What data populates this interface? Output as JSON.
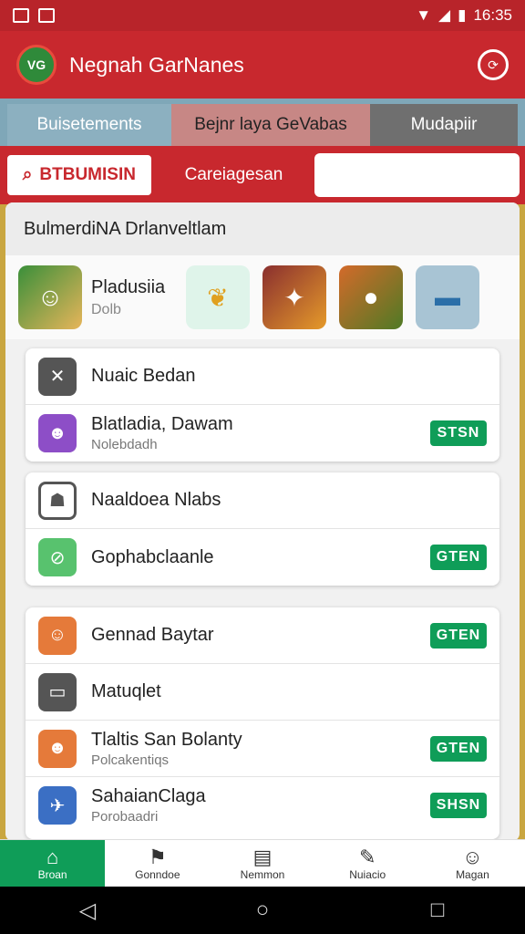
{
  "status_bar": {
    "time": "16:35"
  },
  "app_bar": {
    "logo_text": "VG",
    "title": "Negnah GarNanes"
  },
  "seg_tabs": [
    "Buisetements",
    "Bejnr laya GeVabas",
    "Mudapiir"
  ],
  "chips": {
    "search_label": "BTBUMISIN",
    "category_label": "Careiagesan"
  },
  "section": {
    "title": "BulmerdiNA Drlanveltlam"
  },
  "featured": {
    "title": "Pladusiia",
    "subtitle": "Dolb"
  },
  "list_card_1": [
    {
      "title": "Nuaic Bedan"
    },
    {
      "title": "Blatladia, Dawam",
      "subtitle": "Nolebdadh",
      "action": "STSN"
    }
  ],
  "list_card_2": [
    {
      "title": "Naaldoea Nlabs"
    },
    {
      "title": "Gophabclaanle",
      "action": "GTEN"
    }
  ],
  "list_card_3": [
    {
      "title": "Gennad Baytar",
      "action": "GTEN"
    },
    {
      "title": "Matuqlet"
    },
    {
      "title": "Tlaltis San Bolanty",
      "subtitle": "Polcakentiqs",
      "action": "GTEN"
    },
    {
      "title": "SahaianClaga",
      "subtitle": "Porobaadri",
      "action": "SHSN"
    }
  ],
  "bottom_nav": [
    "Broan",
    "Gonndoe",
    "Nemmon",
    "Nuiacio",
    "Magan"
  ],
  "colors": {
    "primary": "#c8282e",
    "accent_green": "#0f9d58"
  }
}
